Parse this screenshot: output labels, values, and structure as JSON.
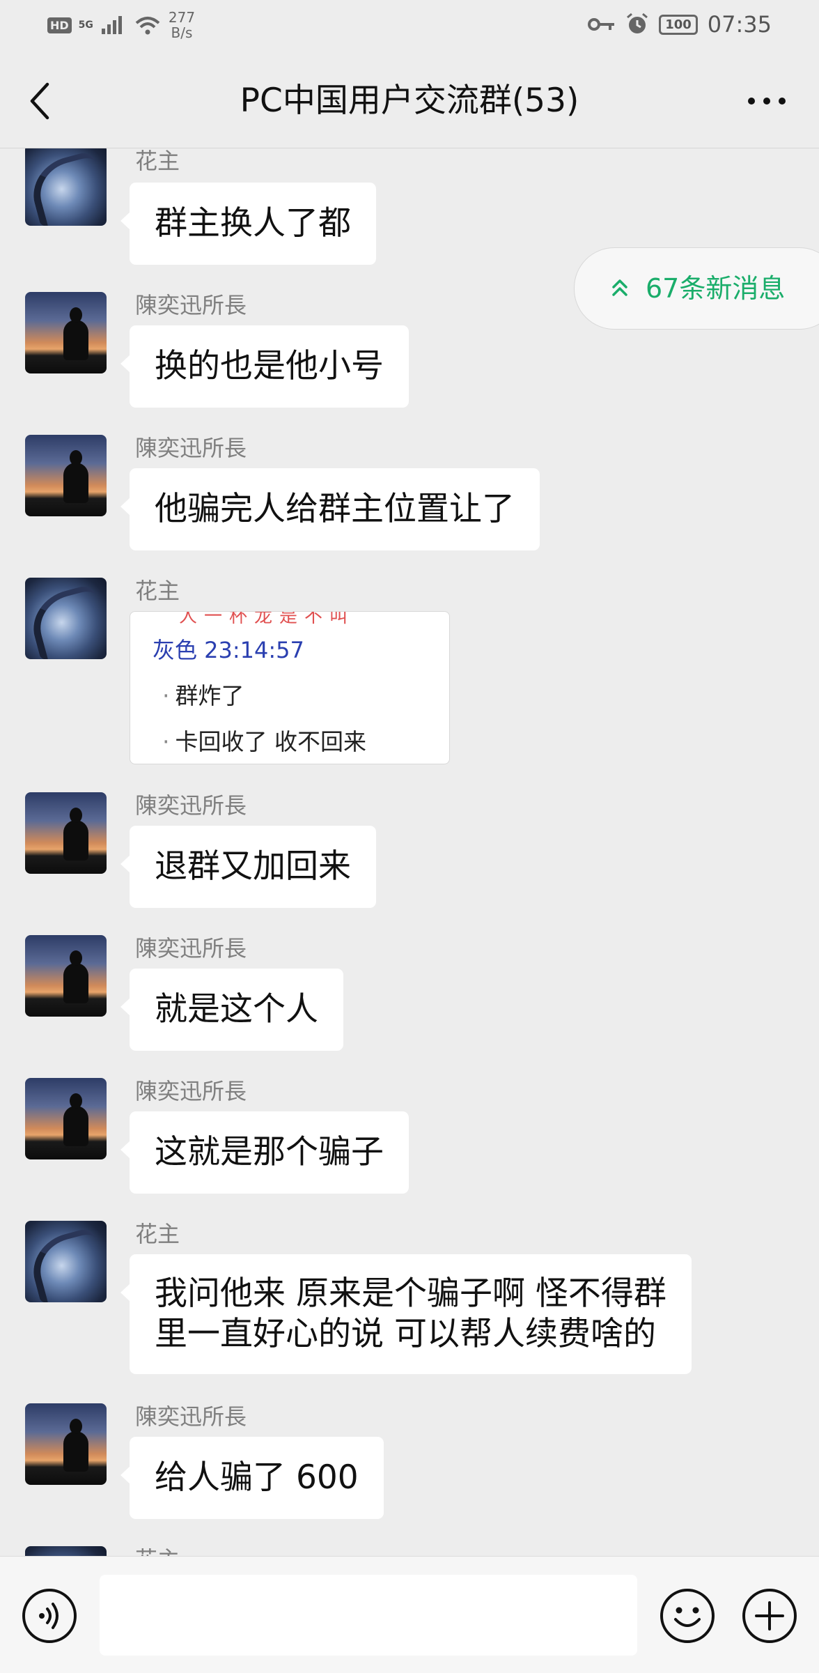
{
  "status_bar": {
    "hd": "HD",
    "network": "5G",
    "speed_value": "277",
    "speed_unit": "B/s",
    "battery": "100",
    "time": "07:35"
  },
  "header": {
    "title": "PC中国用户交流群(53)",
    "back_icon": "chevron-left-icon",
    "more_icon": "more-dots-icon"
  },
  "new_messages_pill": {
    "label": "67条新消息",
    "icon": "double-chevron-up-icon",
    "color": "#1aad6a"
  },
  "messages": [
    {
      "sender": "花主",
      "text": "群主换人了都"
    },
    {
      "sender": "陳奕迅所長",
      "text": "换的也是他小号"
    },
    {
      "sender": "陳奕迅所長",
      "text": "他骗完人给群主位置让了"
    },
    {
      "sender": "花主",
      "image": {
        "top_text": "人一杯龙是不叫",
        "header": "灰色   23:14:57",
        "items": [
          "群炸了",
          "卡回收了 收不回来"
        ]
      }
    },
    {
      "sender": "陳奕迅所長",
      "text": "退群又加回来"
    },
    {
      "sender": "陳奕迅所長",
      "text": "就是这个人"
    },
    {
      "sender": "陳奕迅所長",
      "text": "这就是那个骗子"
    },
    {
      "sender": "花主",
      "text_lines": [
        "我问他来 原来是个骗子啊 怪不得群",
        "里一直好心的说 可以帮人续费啥的"
      ]
    },
    {
      "sender": "陳奕迅所長",
      "text": "给人骗了 600"
    },
    {
      "sender": "花主"
    }
  ],
  "input_bar": {
    "voice_icon": "voice-icon",
    "emoji_icon": "emoji-icon",
    "plus_icon": "plus-circle-icon",
    "input_value": ""
  },
  "colors": {
    "background": "#ededed",
    "bubble": "#ffffff",
    "sender_name": "#7f7f7f",
    "accent_green": "#1aad6a"
  }
}
